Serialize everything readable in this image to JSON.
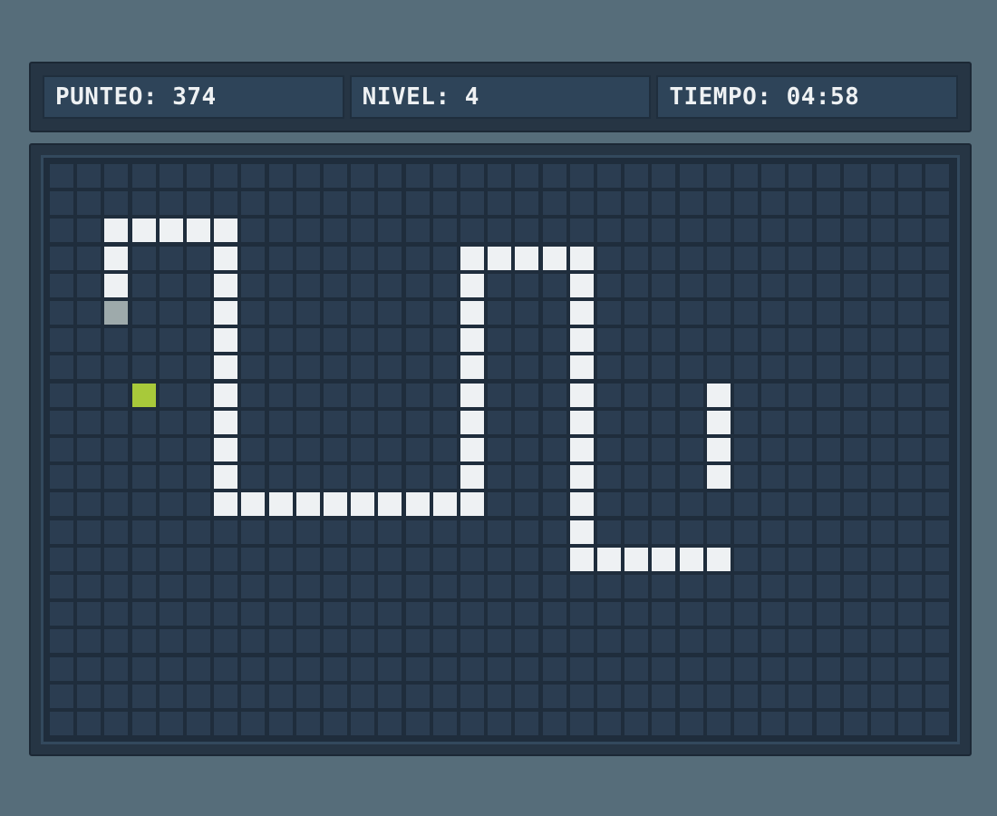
{
  "hud": {
    "score_label": "PUNTEO: 374",
    "level_label": "NIVEL: 4",
    "time_label": "TIEMPO: 04:58"
  },
  "colors": {
    "background": "#566d7a",
    "frame": "#263544",
    "grid_cell": "#2b3d51",
    "snake_body": "#eef1f3",
    "snake_tail": "#9eaaab",
    "food": "#a8c93a"
  },
  "board": {
    "columns": 33,
    "rows": 21,
    "snake": [
      [
        24,
        11
      ],
      [
        24,
        10
      ],
      [
        24,
        9
      ],
      [
        24,
        8
      ],
      [
        23,
        14
      ],
      [
        22,
        14
      ],
      [
        21,
        14
      ],
      [
        20,
        14
      ],
      [
        24,
        14
      ],
      [
        19,
        14
      ],
      [
        19,
        13
      ],
      [
        19,
        12
      ],
      [
        19,
        11
      ],
      [
        19,
        10
      ],
      [
        19,
        9
      ],
      [
        19,
        8
      ],
      [
        19,
        7
      ],
      [
        19,
        6
      ],
      [
        19,
        5
      ],
      [
        19,
        4
      ],
      [
        19,
        3
      ],
      [
        18,
        3
      ],
      [
        17,
        3
      ],
      [
        16,
        3
      ],
      [
        15,
        3
      ],
      [
        15,
        4
      ],
      [
        15,
        5
      ],
      [
        15,
        6
      ],
      [
        15,
        7
      ],
      [
        15,
        8
      ],
      [
        15,
        9
      ],
      [
        15,
        10
      ],
      [
        15,
        11
      ],
      [
        15,
        12
      ],
      [
        14,
        12
      ],
      [
        13,
        12
      ],
      [
        12,
        12
      ],
      [
        11,
        12
      ],
      [
        10,
        12
      ],
      [
        9,
        12
      ],
      [
        8,
        12
      ],
      [
        7,
        12
      ],
      [
        6,
        12
      ],
      [
        6,
        11
      ],
      [
        6,
        10
      ],
      [
        6,
        9
      ],
      [
        6,
        8
      ],
      [
        6,
        7
      ],
      [
        6,
        6
      ],
      [
        6,
        5
      ],
      [
        6,
        4
      ],
      [
        6,
        3
      ],
      [
        6,
        2
      ],
      [
        5,
        2
      ],
      [
        4,
        2
      ],
      [
        3,
        2
      ],
      [
        2,
        2
      ],
      [
        2,
        3
      ],
      [
        2,
        4
      ]
    ],
    "snake_tail": [
      [
        2,
        5
      ]
    ],
    "food": [
      [
        3,
        8
      ]
    ]
  }
}
